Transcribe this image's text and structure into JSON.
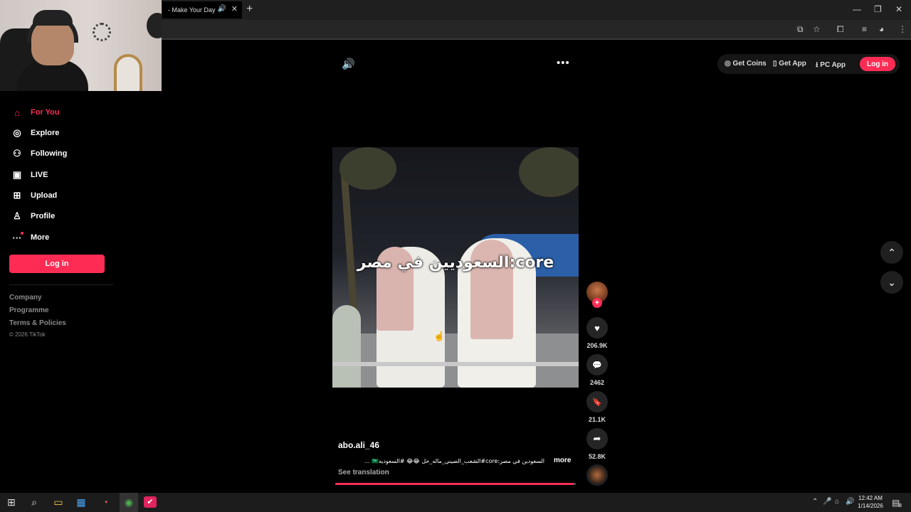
{
  "browser": {
    "tab_title": "- Make Your Day",
    "speaker_glyph": "🔊",
    "close_glyph": "✕",
    "newtab_glyph": "+",
    "minimize_glyph": "—",
    "restore_glyph": "❐",
    "winclose_glyph": "✕",
    "toolbar_icons": [
      "cast-icon",
      "star-icon",
      "extensions-icon",
      "media-icon",
      "profile-icon",
      "menu-icon"
    ]
  },
  "sidebar": {
    "items": [
      {
        "label": "For You",
        "icon": "home-icon",
        "glyph": "⌂",
        "active": true
      },
      {
        "label": "Explore",
        "icon": "compass-icon",
        "glyph": "◎",
        "active": false
      },
      {
        "label": "Following",
        "icon": "following-icon",
        "glyph": "⚇",
        "active": false
      },
      {
        "label": "LIVE",
        "icon": "live-icon",
        "glyph": "▣",
        "active": false
      },
      {
        "label": "Upload",
        "icon": "upload-icon",
        "glyph": "⊞",
        "active": false
      },
      {
        "label": "Profile",
        "icon": "profile-icon",
        "glyph": "♙",
        "active": false
      },
      {
        "label": "More",
        "icon": "more-icon",
        "glyph": "···",
        "active": false
      }
    ],
    "login_label": "Log in",
    "footer_links": [
      "Company",
      "Programme",
      "Terms & Policies"
    ],
    "copyright": "© 2026 TikTok"
  },
  "topbar": {
    "volume_glyph": "🔊",
    "options_glyph": "•••",
    "actions": [
      {
        "label": "Get Coins",
        "glyph": "◎"
      },
      {
        "label": "Get App",
        "glyph": "▯"
      },
      {
        "label": "PC App",
        "glyph": "⭳"
      }
    ],
    "login_label": "Log in"
  },
  "video": {
    "caption": "السعوديين في مصر:core",
    "author": "abo.ali_46",
    "description": "السعودين في مصر:core#الشعب_الصيني_ماله_حل 😂😂 #السعوديه🇸🇦 ...",
    "more_label": "more",
    "see_translation": "See translation",
    "progress_percent": 99
  },
  "rail": {
    "follow_glyph": "+",
    "like_glyph": "♥",
    "likes": "206.9K",
    "comment_glyph": "💬",
    "comments": "2462",
    "save_glyph": "🔖",
    "saves": "21.1K",
    "share_glyph": "➦",
    "shares": "52.8K"
  },
  "scroll": {
    "up_glyph": "⌃",
    "down_glyph": "⌄"
  },
  "taskbar": {
    "start_glyph": "⊞",
    "search_glyph": "⌕",
    "explorer_glyph": "▭",
    "store_glyph": "▦",
    "app_glyph": "◔",
    "chrome_glyph": "◉",
    "red_app_glyph": "✔",
    "tray_glyphs": [
      "⌃",
      "🎤",
      "⌂",
      "🔊"
    ],
    "time": "12:42 AM",
    "date": "1/14/2026",
    "notification_glyph": "▤",
    "notification_count": "8"
  },
  "colors": {
    "accent": "#fe2c55",
    "background": "#000000"
  }
}
